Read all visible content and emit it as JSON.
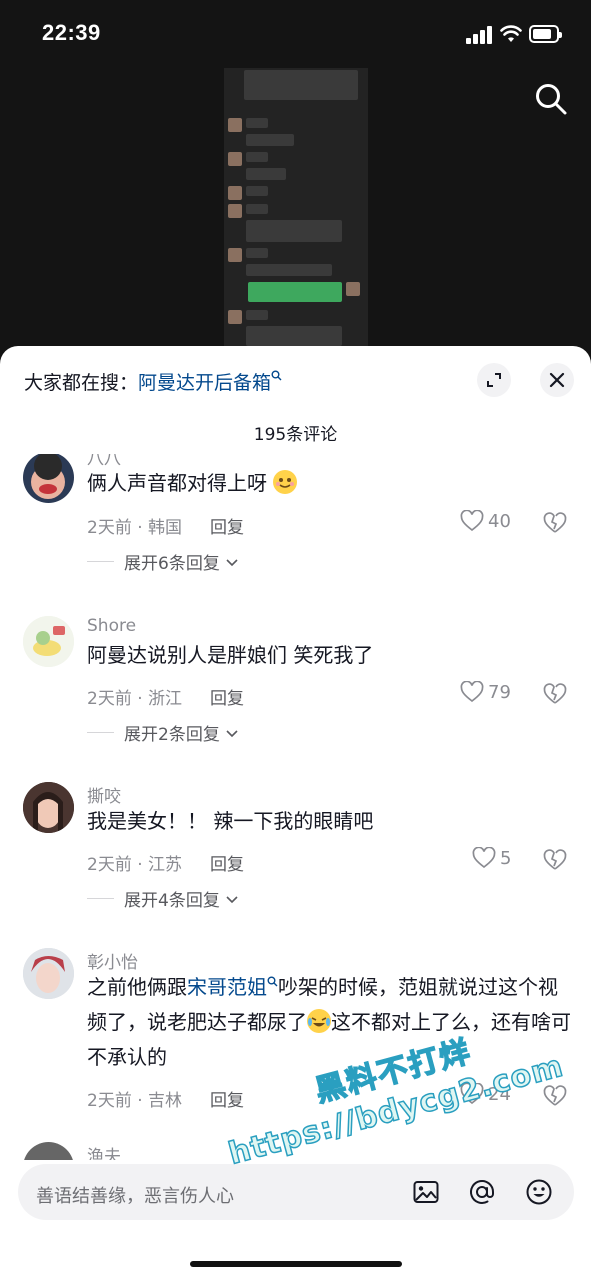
{
  "status_bar": {
    "time": "22:39"
  },
  "panel": {
    "search_prefix": "大家都在搜：",
    "search_term": "阿曼达开后备箱",
    "comment_count": "195条评论"
  },
  "comments": [
    {
      "name": "八八",
      "text": "俩人声音都对得上呀",
      "meta": "2天前 · 韩国",
      "reply": "回复",
      "likes": "40",
      "expand": "展开6条回复"
    },
    {
      "name": "Shore",
      "text": "阿曼达说别人是胖娘们 笑死我了",
      "meta": "2天前 · 浙江",
      "reply": "回复",
      "likes": "79",
      "expand": "展开2条回复"
    },
    {
      "name": "撕咬",
      "text": "我是美女！！ 辣一下我的眼睛吧",
      "meta": "2天前 · 江苏",
      "reply": "回复",
      "likes": "5",
      "expand": "展开4条回复"
    },
    {
      "name": "彰小怡",
      "text_before": "之前他俩跟",
      "text_link": "宋哥范姐",
      "text_after": "吵架的时候，范姐就说过这个视频了，说老肥达子都尿了",
      "text_end": "这不都对上了么，还有啥可不承认的",
      "meta": "2天前 · 吉林",
      "reply": "回复",
      "likes": "24"
    },
    {
      "name": "渔夫"
    }
  ],
  "input": {
    "placeholder": "善语结善缘，恶言伤人心"
  },
  "watermark": {
    "line1": "黑料不打烊",
    "line2": "https://bdycg2.com"
  }
}
